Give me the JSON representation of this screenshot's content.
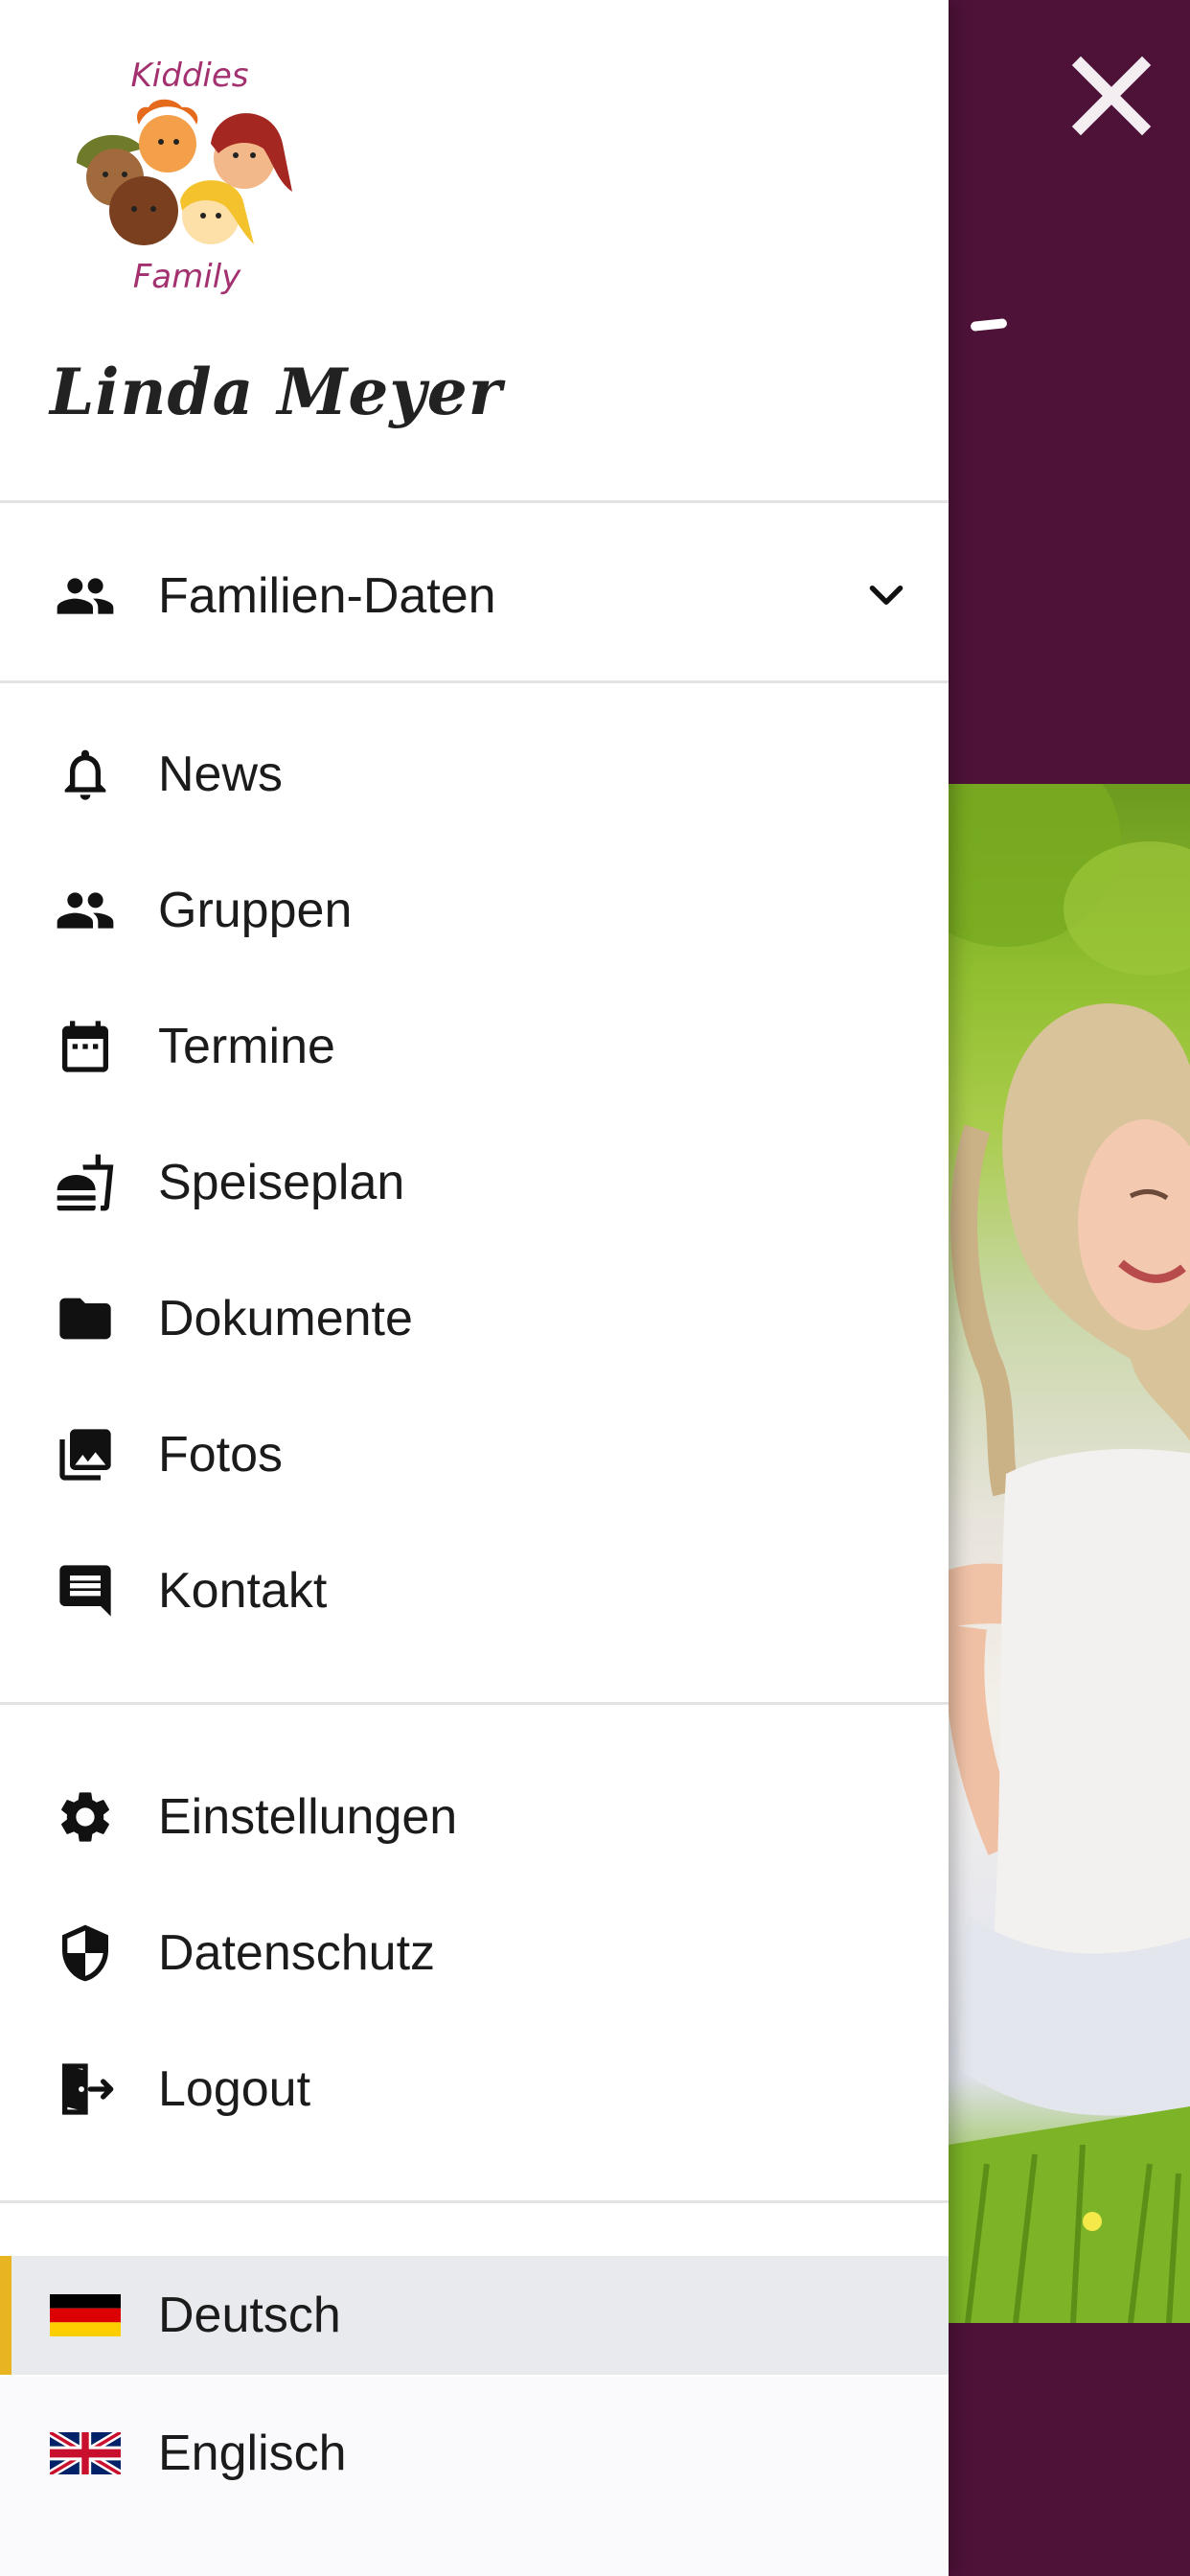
{
  "background": {
    "accent": "#4e1239",
    "close_icon": "close-icon"
  },
  "drawer": {
    "logo": {
      "text_top": "Kiddies",
      "text_bottom": "Family"
    },
    "user_name": "Linda Meyer",
    "family_section": {
      "label": "Familien-Daten",
      "icon": "group-icon",
      "expand_icon": "chevron-down-icon"
    },
    "main_items": [
      {
        "label": "News",
        "icon": "bell-icon"
      },
      {
        "label": "Gruppen",
        "icon": "group-icon"
      },
      {
        "label": "Termine",
        "icon": "calendar-icon"
      },
      {
        "label": "Speiseplan",
        "icon": "food-icon"
      },
      {
        "label": "Dokumente",
        "icon": "folder-icon"
      },
      {
        "label": "Fotos",
        "icon": "photo-library-icon"
      },
      {
        "label": "Kontakt",
        "icon": "message-icon"
      }
    ],
    "settings_items": [
      {
        "label": "Einstellungen",
        "icon": "gear-icon"
      },
      {
        "label": "Datenschutz",
        "icon": "shield-icon"
      },
      {
        "label": "Logout",
        "icon": "logout-icon"
      }
    ],
    "languages": [
      {
        "label": "Deutsch",
        "icon": "german-flag-icon",
        "selected": true
      },
      {
        "label": "Englisch",
        "icon": "uk-flag-icon",
        "selected": false
      }
    ],
    "selection_color": "#e8b422"
  }
}
